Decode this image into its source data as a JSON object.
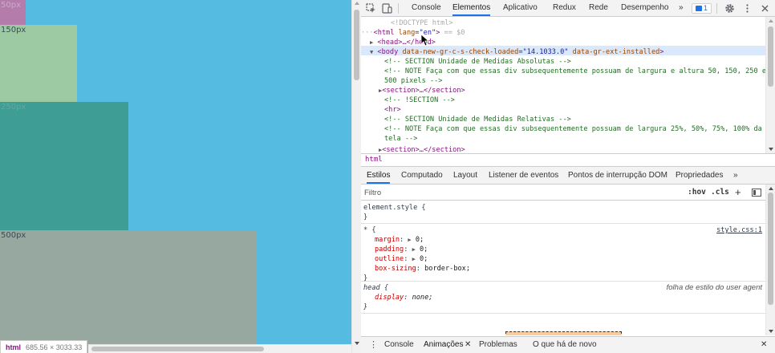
{
  "viewport": {
    "boxes": [
      {
        "id": "50",
        "label": "50px"
      },
      {
        "id": "150",
        "label": "150px"
      },
      {
        "id": "250",
        "label": "250px"
      },
      {
        "id": "500",
        "label": "500px"
      }
    ],
    "tooltip": {
      "tag": "html",
      "dims": "685.56 × 3033.33"
    }
  },
  "devtools": {
    "tabs": [
      "Console",
      "Elementos",
      "Aplicativo",
      "Redux",
      "Rede",
      "Desempenho"
    ],
    "active_tab": "Elementos",
    "more_tabs": "»",
    "issues_count": "1",
    "dom_lines": {
      "doctype": "<!DOCTYPE html>",
      "html_open_tag": "<html",
      "html_attr_name": "lang",
      "html_attr_val": "\"en\"",
      "html_close": ">",
      "html_eq": " == $0",
      "head": "<head>…</head>",
      "body_tag": "<body",
      "body_attr1": "data-new-gr-c-s-check-loaded",
      "body_val1": "\"14.1033.0\"",
      "body_attr2": "data-gr-ext-installed",
      "body_close": ">",
      "c1": "<!-- SECTION Unidade de Medidas Absolutas -->",
      "c2a": "<!-- NOTE Faça com que essas div subsequentemente possuam de largura e altura 50, 150, 250 e",
      "c2b": "500 pixels -->",
      "section1": "<section>…</section>",
      "c3": "<!-- !SECTION -->",
      "hr": "<hr>",
      "c4": "<!-- SECTION Unidade de Medidas Relativas -->",
      "c5a": "<!-- NOTE Faça com que essas div subsequentemente possuam de largura 25%, 50%, 75%, 100% da",
      "c5b": "tela -->",
      "section2": "<section>…</section>"
    },
    "breadcrumb": "html",
    "subtabs": [
      "Estilos",
      "Computado",
      "Layout",
      "Listener de eventos",
      "Pontos de interrupção DOM",
      "Propriedades"
    ],
    "subtabs_more": "»",
    "filter": {
      "placeholder": "Filtro",
      "hov": ":hov",
      "cls": ".cls",
      "add": "+"
    },
    "styles": {
      "element_style": "element.style {",
      "close_brace": "}",
      "rule1_selector": "* {",
      "rule1_source": "style.css:1",
      "rule1_props": [
        {
          "name": "margin",
          "value": "0;"
        },
        {
          "name": "padding",
          "value": "0;"
        },
        {
          "name": "outline",
          "value": "0;"
        },
        {
          "name": "box-sizing",
          "value": "border-box;"
        }
      ],
      "rule2_selector": "head {",
      "rule2_source": "folha de estilo do user agent",
      "rule2_prop_name": "display",
      "rule2_prop_value": "none;"
    },
    "drawer": {
      "tabs": [
        "Console",
        "Animações",
        "Problemas",
        "O que há de novo"
      ],
      "active": "Animações",
      "close": "✕"
    }
  },
  "colors": {
    "page_bg": "#55bbe0",
    "box50": "#b47cab",
    "box150": "#9ecaa3",
    "box250": "#3e9e96",
    "box500": "#96a8a0",
    "accent": "#1a73e8"
  },
  "icons": [
    "inspect-icon",
    "device-toggle-icon",
    "issues-icon",
    "settings-gear-icon",
    "kebab-menu-icon",
    "close-icon"
  ]
}
